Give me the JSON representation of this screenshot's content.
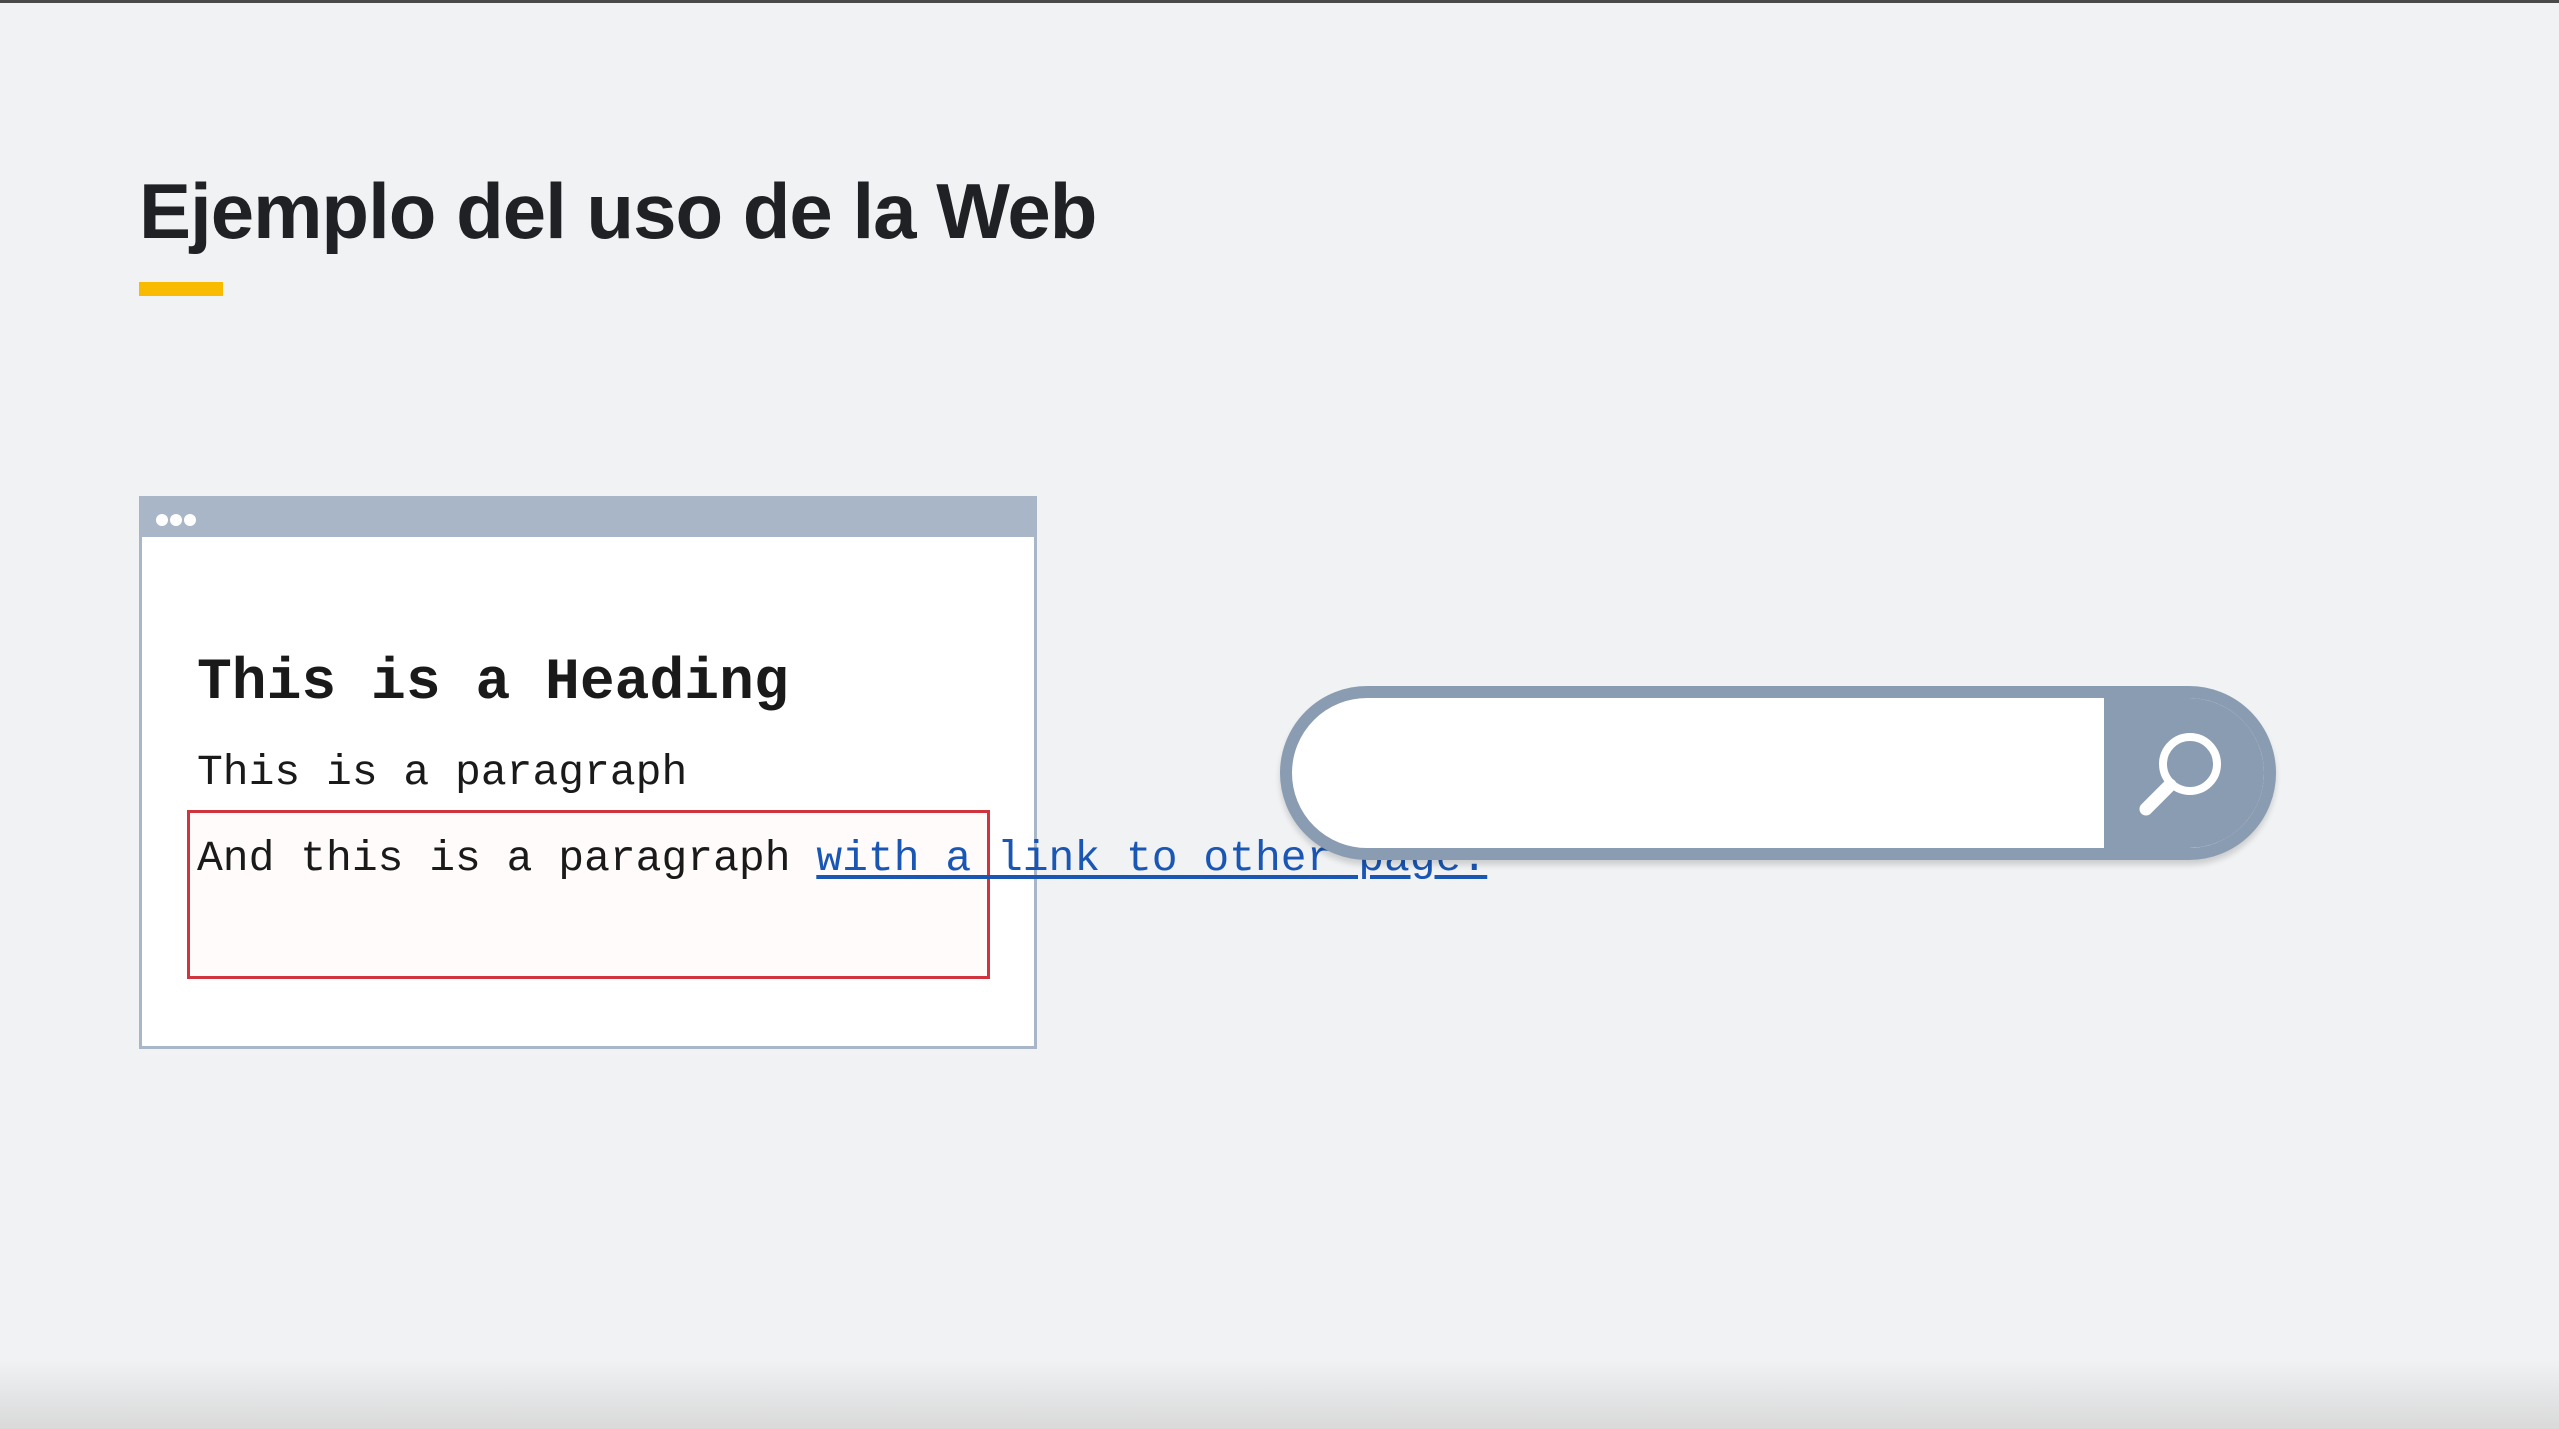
{
  "slide": {
    "title": "Ejemplo del uso de la Web",
    "accent_color": "#f9bb00",
    "background_color": "#f0f2f4"
  },
  "browser_mock": {
    "chrome_color": "#a9b6c7",
    "heading": "This is a Heading",
    "paragraph": "This is a paragraph",
    "link_paragraph": {
      "text": "And this is a paragraph ",
      "link_text": "with a link to other page.",
      "link_color": "#1a56b4",
      "highlight_color": "#d0353f"
    }
  },
  "search": {
    "input_value": "",
    "placeholder": "",
    "icon": "magnifier-icon",
    "bar_color": "#8a9cb2"
  }
}
